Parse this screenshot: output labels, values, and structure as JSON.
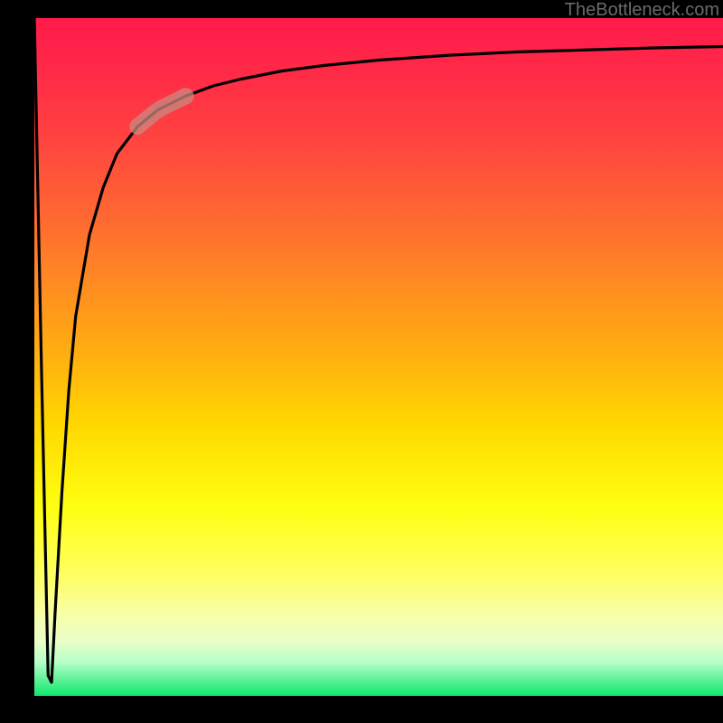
{
  "attribution": "TheBottleneck.com",
  "chart_data": {
    "type": "line",
    "title": "",
    "xlabel": "",
    "ylabel": "",
    "xlim": [
      0,
      100
    ],
    "ylim": [
      0,
      100
    ],
    "x": [
      0,
      1,
      2,
      2.5,
      3,
      4,
      5,
      6,
      8,
      10,
      12,
      15,
      18,
      22,
      26,
      30,
      36,
      42,
      50,
      60,
      70,
      80,
      90,
      100
    ],
    "values": [
      100,
      50,
      3,
      2,
      12,
      30,
      45,
      56,
      68,
      75,
      80,
      84,
      86.5,
      88.5,
      90,
      91,
      92.2,
      93,
      93.8,
      94.5,
      95,
      95.3,
      95.6,
      95.8
    ],
    "highlight_segment": {
      "x_start": 15,
      "x_end": 22,
      "note": "emphasized region on curve"
    },
    "background_gradient": {
      "top_color": "#ff1a4a",
      "bottom_color": "#10e870",
      "type": "vertical"
    }
  }
}
